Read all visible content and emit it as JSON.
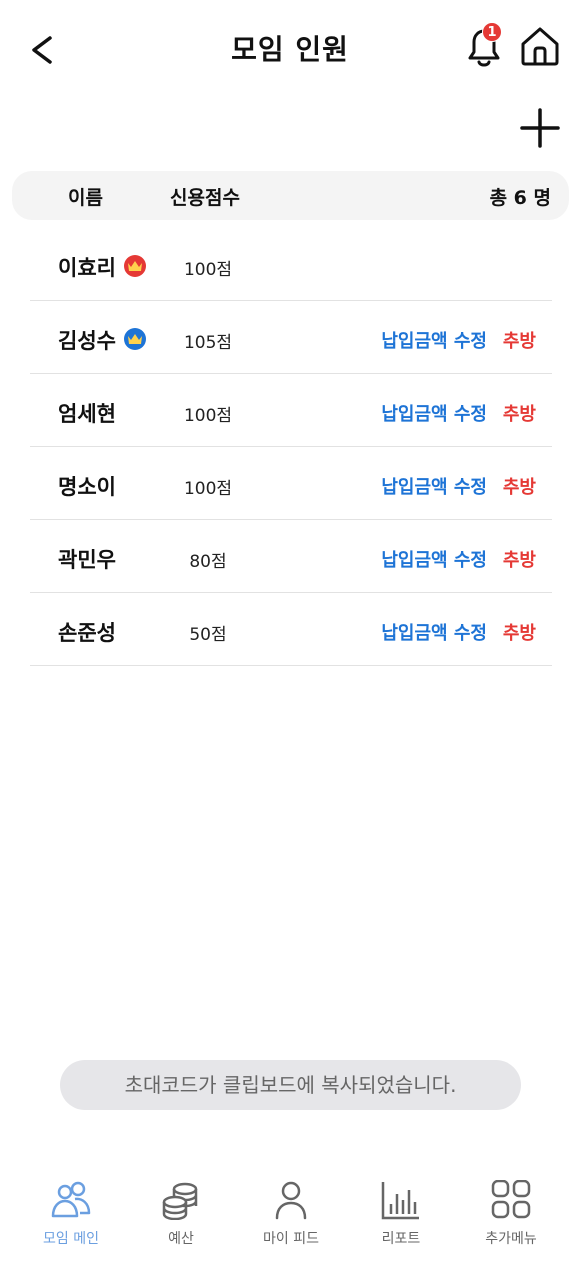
{
  "header": {
    "title": "모임 인원",
    "notification_count": "1"
  },
  "table": {
    "col_name": "이름",
    "col_score": "신용점수",
    "total": "총 6 명"
  },
  "members": [
    {
      "name": "이효리",
      "score": "100점",
      "badge": "crown-red",
      "edit_label": "",
      "kick_label": ""
    },
    {
      "name": "김성수",
      "score": "105점",
      "badge": "crown-blue",
      "edit_label": "납입금액 수정",
      "kick_label": "추방"
    },
    {
      "name": "엄세현",
      "score": "100점",
      "badge": "",
      "edit_label": "납입금액 수정",
      "kick_label": "추방"
    },
    {
      "name": "명소이",
      "score": "100점",
      "badge": "",
      "edit_label": "납입금액 수정",
      "kick_label": "추방"
    },
    {
      "name": "곽민우",
      "score": "80점",
      "badge": "",
      "edit_label": "납입금액 수정",
      "kick_label": "추방"
    },
    {
      "name": "손준성",
      "score": "50점",
      "badge": "",
      "edit_label": "납입금액 수정",
      "kick_label": "추방"
    }
  ],
  "toast": {
    "message": "초대코드가 클립보드에 복사되었습니다."
  },
  "nav": {
    "items": [
      {
        "label": "모임 메인",
        "icon": "people-icon",
        "active": true
      },
      {
        "label": "예산",
        "icon": "coins-icon",
        "active": false
      },
      {
        "label": "마이 피드",
        "icon": "person-icon",
        "active": false
      },
      {
        "label": "리포트",
        "icon": "bar-chart-icon",
        "active": false
      },
      {
        "label": "추가메뉴",
        "icon": "grid-icon",
        "active": false
      }
    ]
  },
  "colors": {
    "accent_blue": "#1e74d6",
    "danger_red": "#e53935",
    "nav_active": "#6b9fe0"
  }
}
